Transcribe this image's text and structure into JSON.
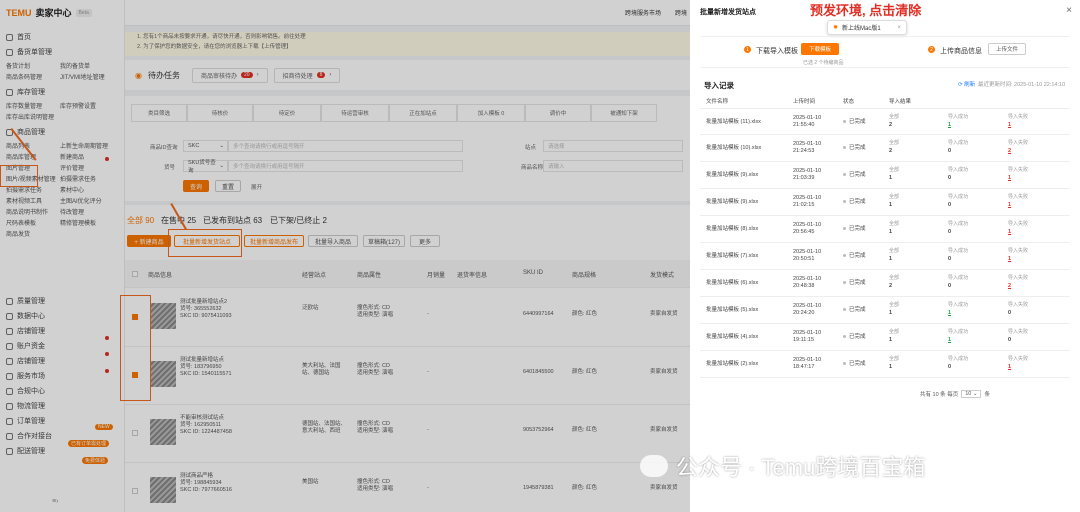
{
  "header": {
    "logo": "TEMU",
    "logo_sub": "卖家中心",
    "beta": "Beta",
    "links": [
      "跨境服务市场",
      "跨境"
    ]
  },
  "sidebar": {
    "home": "首页",
    "s1": "备货单管理",
    "s1_items": [
      "备货计划",
      "我的备货单",
      "商品条码管理",
      "JIT/VMI地址管理"
    ],
    "s2": "库存管理",
    "s2_items": [
      "库存数量管理",
      "库存预警设置",
      "库存出库说明管理"
    ],
    "s3": "商品管理",
    "s3_items": [
      "商品列表",
      "上新生命周期管理",
      "商品库管理",
      "新建商品",
      "图片管理",
      "评价管理",
      "图片/视频素材管理",
      "拍摄需求任务",
      "拍摄需求任务",
      "素材中心",
      "素材视频工具",
      "主图AI优化评分",
      "商品说明书制作",
      "待改管理",
      "尺码表模板",
      "精修管理模板",
      "商品发货"
    ],
    "sections": [
      "质量管理",
      "数据中心",
      "店铺管理",
      "账户资金",
      "店铺管理",
      "服务市场",
      "合规中心",
      "物流管理",
      "订单管理",
      "合作对接台",
      "配送管理"
    ],
    "badge_new": "NEW",
    "badge_hot": "已有订单需处理",
    "badge_limit": "免费体验"
  },
  "notice": {
    "line1": "1. 您有1个商品未按要求开通，请尽快开通，否则影响销售。前往处理",
    "line2": "2. 为了保护您的数据安全，请在您的浏览器上下载【上传管理】"
  },
  "tasks": {
    "label": "待办任务",
    "btn1": "商品审核待办",
    "btn1_count": "20",
    "btn2": "招商待处理",
    "btn2_count": "8"
  },
  "filters": {
    "cells": [
      "类目筛选",
      "待核价",
      "待定价",
      "待运营审核",
      "正在加站点",
      "加入模板 0",
      "调价中",
      "被通知下架"
    ],
    "code_label": "商品ID查询",
    "code_sel": "SKC",
    "code_ph": "多个查询请换行或用逗号隔开",
    "site_label": "站点",
    "site_ph": "请选择",
    "sku_label": "货号",
    "sku_sel": "SKU货号查询",
    "sku_ph": "多个查询请换行或用逗号隔开",
    "name_label": "商品名称",
    "name_ph": "请输入",
    "search": "查询",
    "reset": "重置",
    "more": "展开"
  },
  "list": {
    "tabs": [
      "全部 90",
      "在售中 25",
      "已发布到站点 63",
      "已下架/已终止 2"
    ],
    "btns": [
      "+ 新建商品",
      "批量新增发货站点",
      "批量新增商品发布",
      "批量导入商品",
      "草稿箱(127)",
      "更多"
    ],
    "cols": [
      "商品信息",
      "经营站点",
      "商品属性",
      "月销量",
      "退货率信息",
      "SKU ID",
      "商品规格",
      "发货模式"
    ],
    "rows": [
      {
        "title": "测试批量新增站点2",
        "id": "货号: 365552632",
        "skc": "SKC ID: 9075411093",
        "sites": "泛欧站",
        "attr": "撞色形式: CD\n适用类型: 演唱",
        "dash": "-",
        "sku": "6440997164",
        "spec": "颜色: 红色",
        "mode": "卖家自发货",
        "checked": true
      },
      {
        "title": "测试批量新增站点",
        "id": "货号: 183796950",
        "skc": "SKC ID: 1540115571",
        "sites": "美大利站、法国站、德国站",
        "attr": "撞色形式: CD\n适用类型: 演唱",
        "dash": "-",
        "sku": "6401845500",
        "spec": "颜色: 红色",
        "mode": "卖家自发货",
        "checked": true
      },
      {
        "title": "不能审核测试站点",
        "id": "货号: 162950511",
        "skc": "SKC ID: 1224487458",
        "sites": "德国站、法国站、意大利站、西班",
        "attr": "撞色形式: CD\n适用类型: 演唱",
        "dash": "-",
        "sku": "9053752964",
        "spec": "颜色: 红色",
        "mode": "卖家自发货",
        "checked": false
      },
      {
        "title": "测试商品严格",
        "id": "货号: 198845934",
        "skc": "SKC ID: 7977660516",
        "sites": "美国站",
        "attr": "撞色形式: CD\n适用类型: 演唱",
        "dash": "-",
        "sku": "1945879381",
        "spec": "颜色: 红色",
        "mode": "卖家自发货",
        "checked": false
      }
    ]
  },
  "drawer": {
    "title": "批量新增发货站点",
    "close": "×",
    "annotation": "预发环境, 点击清除",
    "tooltip": "新上线Mac版1",
    "step1": "下载导入模板",
    "step1_btn": "下载模板",
    "step1_note": "已选 2 个待编商品",
    "step2": "上传商品信息",
    "step2_btn": "上传文件",
    "records_title": "导入记录",
    "refresh": "刷新",
    "ts": "最近更新时间: 2025-01-10 22:14:10",
    "cols": [
      "文件名称",
      "上传时间",
      "状态",
      "导入结果"
    ],
    "rows": [
      {
        "name": "批量加站模板 (11).xlsx",
        "date": "2025-01-10",
        "time": "21:55:40",
        "status": "已完成",
        "all": "2",
        "ok": "1",
        "fail": "1"
      },
      {
        "name": "批量加站模板 (10).xlsx",
        "date": "2025-01-10",
        "time": "21:24:53",
        "status": "已完成",
        "all": "2",
        "ok": "0",
        "fail": "2"
      },
      {
        "name": "批量加站模板 (9).xlsx",
        "date": "2025-01-10",
        "time": "21:03:39",
        "status": "已完成",
        "all": "1",
        "ok": "0",
        "fail": "1"
      },
      {
        "name": "批量加站模板 (9).xlsx",
        "date": "2025-01-10",
        "time": "21:02:15",
        "status": "已完成",
        "all": "1",
        "ok": "0",
        "fail": "1"
      },
      {
        "name": "批量加站模板 (8).xlsx",
        "date": "2025-01-10",
        "time": "20:56:45",
        "status": "已完成",
        "all": "1",
        "ok": "0",
        "fail": "1"
      },
      {
        "name": "批量加站模板 (7).xlsx",
        "date": "2025-01-10",
        "time": "20:50:51",
        "status": "已完成",
        "all": "1",
        "ok": "0",
        "fail": "1"
      },
      {
        "name": "批量加站模板 (6).xlsx",
        "date": "2025-01-10",
        "time": "20:48:38",
        "status": "已完成",
        "all": "2",
        "ok": "0",
        "fail": "2"
      },
      {
        "name": "批量加站模板 (5).xlsx",
        "date": "2025-01-10",
        "time": "20:24:20",
        "status": "已完成",
        "all": "1",
        "ok": "1",
        "fail": "0"
      },
      {
        "name": "批量加站模板 (4).xlsx",
        "date": "2025-01-10",
        "time": "19:11:15",
        "status": "已完成",
        "all": "1",
        "ok": "1",
        "fail": "0"
      },
      {
        "name": "批量加站模板 (2).xlsx",
        "date": "2025-01-10",
        "time": "18:47:17",
        "status": "已完成",
        "all": "1",
        "ok": "0",
        "fail": "1"
      }
    ],
    "lbl_all": "全部",
    "lbl_ok": "导入成功",
    "lbl_fail": "导入失败",
    "pager": "共有 10 条  每页",
    "pager_size": "10",
    "pager_unit": "条"
  },
  "watermark": "公众号 · Temu跨境百宝箱"
}
